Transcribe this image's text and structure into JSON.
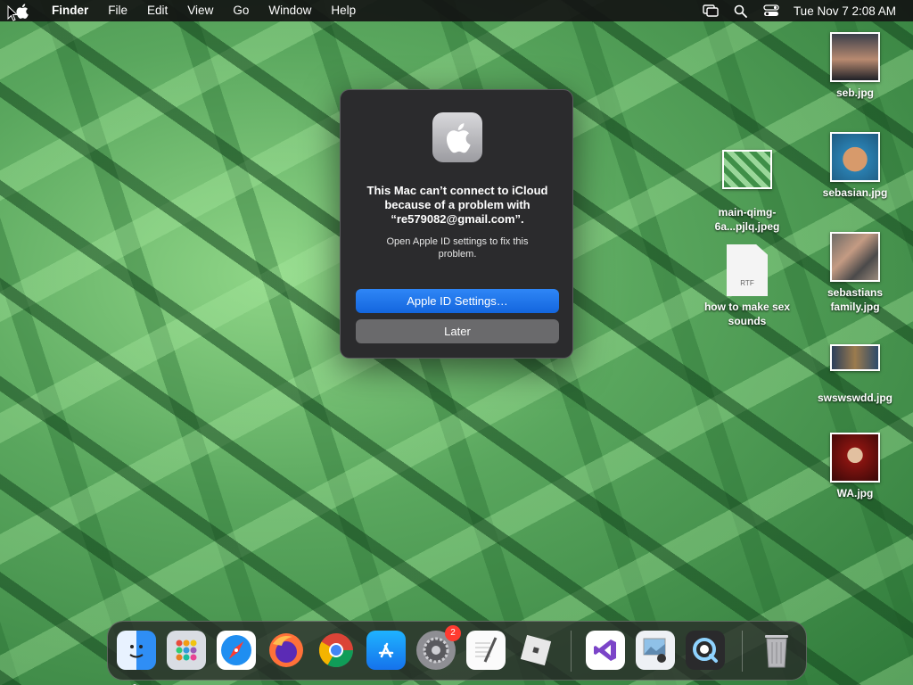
{
  "menubar": {
    "app_name": "Finder",
    "menus": [
      "File",
      "Edit",
      "View",
      "Go",
      "Window",
      "Help"
    ],
    "clock": "Tue Nov 7  2:08 AM",
    "status_icons": [
      "screen-mirroring-icon",
      "search-icon",
      "control-center-icon"
    ]
  },
  "dialog": {
    "title": "This Mac can’t connect to iCloud because of a problem with “re579082@gmail.com”.",
    "message": "Open Apple ID settings to fix this problem.",
    "primary_button": "Apple ID Settings…",
    "secondary_button": "Later"
  },
  "desktop_files": [
    {
      "name": "seb.jpg"
    },
    {
      "name": "sebasian.jpg"
    },
    {
      "name": "main-qimg-6a...pjlq.jpeg"
    },
    {
      "name": "how to make sex sounds",
      "badge": "RTF"
    },
    {
      "name": "sebastians family.jpg"
    },
    {
      "name": "swswswdd.jpg"
    },
    {
      "name": "WA.jpg"
    }
  ],
  "dock": {
    "apps": [
      "Finder",
      "Launchpad",
      "Safari",
      "Firefox",
      "Chrome",
      "App Store",
      "System Settings",
      "TextEdit",
      "Roblox",
      "Visual Studio",
      "Preview",
      "QuickTime Player",
      "Trash"
    ],
    "system_settings_badge": "2"
  },
  "colors": {
    "accent": "#1a73e8",
    "dialog_bg": "#2b2b2d",
    "menubar_bg": "#141414"
  }
}
